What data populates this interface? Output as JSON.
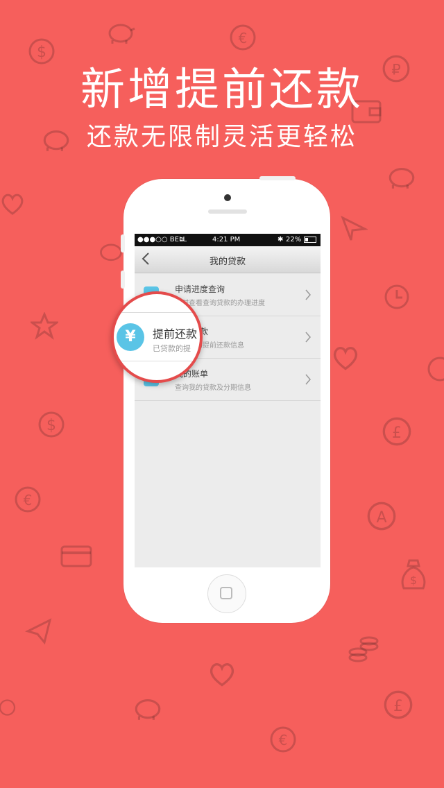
{
  "promo": {
    "headline": "新增提前还款",
    "subline": "还款无限制灵活更轻松"
  },
  "statusbar": {
    "carrier": "●●●○○ BELL",
    "time": "4:21 PM",
    "battery": "22%"
  },
  "navbar": {
    "title": "我的贷款"
  },
  "menu": [
    {
      "title": "申请进度查询",
      "subtitle": "实时查看查询贷款的办理进度"
    },
    {
      "title": "提前还款",
      "subtitle": "已贷款的提前还款信息"
    },
    {
      "title": "我的账单",
      "subtitle": "查询我的贷款及分期信息"
    }
  ],
  "magnifier": {
    "icon": "¥",
    "title": "提前还款",
    "subtitle": "已贷款的提"
  },
  "colors": {
    "background": "#f65f5c",
    "accent": "#5ac4e6",
    "ring": "#e44b4b"
  }
}
